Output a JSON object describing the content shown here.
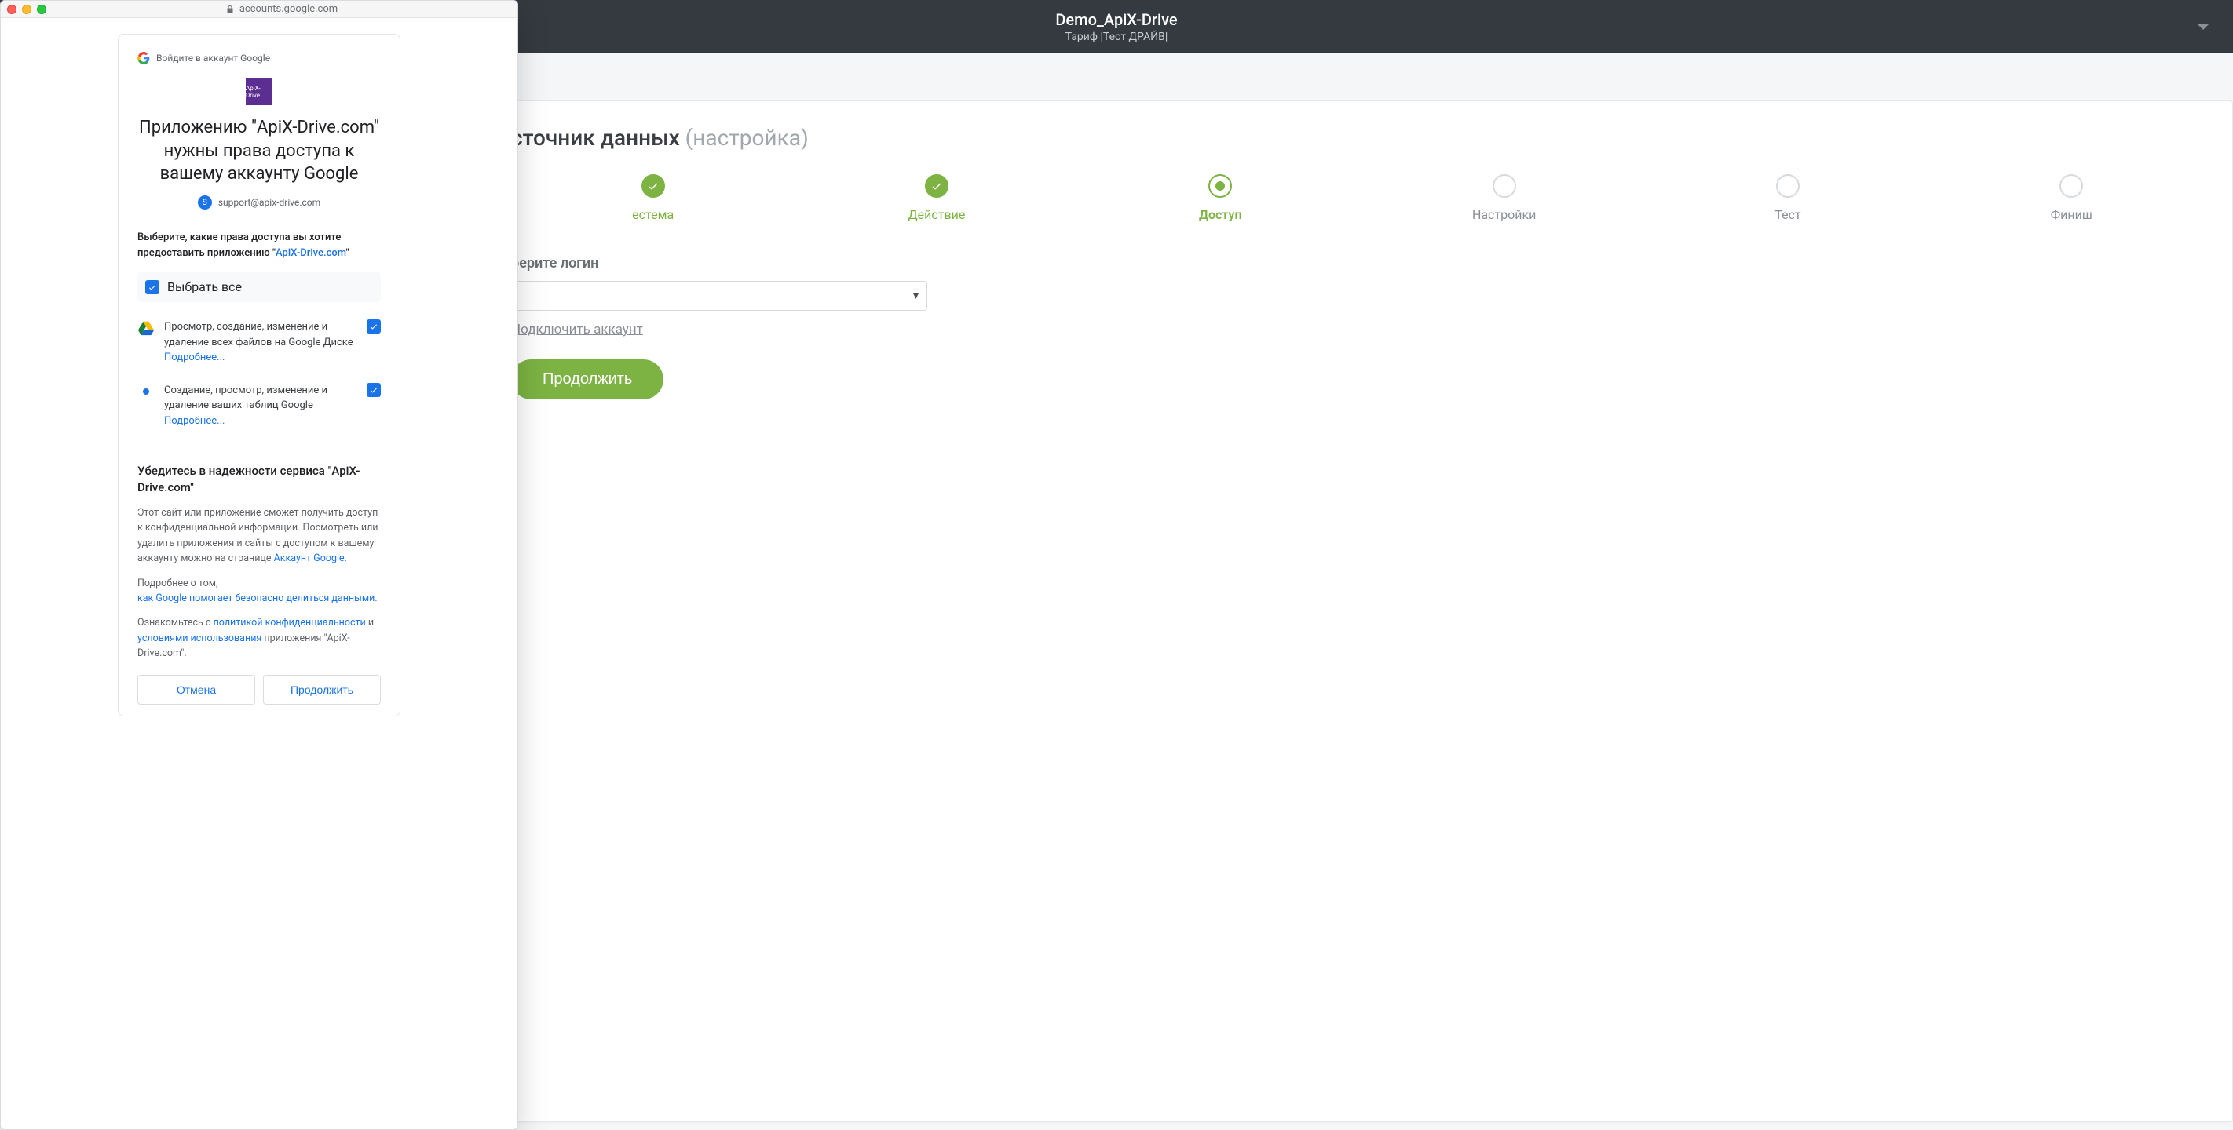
{
  "app": {
    "header": {
      "title": "Demo_ApiX-Drive",
      "subtitle": "Тариф |Тест ДРАЙВ|"
    },
    "panel": {
      "title_main": "сточник данных",
      "title_muted": "(настройка)",
      "steps": [
        {
          "label": "естема",
          "state": "done"
        },
        {
          "label": "Действие",
          "state": "done"
        },
        {
          "label": "Доступ",
          "state": "active"
        },
        {
          "label": "Настройки",
          "state": ""
        },
        {
          "label": "Тест",
          "state": ""
        },
        {
          "label": "Финиш",
          "state": ""
        }
      ],
      "field_label": "берите логин",
      "connect_link": "Подключить аккаунт",
      "continue": "Продолжить"
    }
  },
  "popup": {
    "url": "accounts.google.com",
    "brand_text": "Войдите в аккаунт Google",
    "app_icon_text": "ApiX-Drive",
    "heading": "Приложению \"ApiX-Drive.com\" нужны права доступа к вашему аккаунту Google",
    "account_chip_letter": "S",
    "account_email": "support@apix-drive.com",
    "select_title_1": "Выберите, какие права доступа вы хотите предоставить приложению \"",
    "select_title_app": "ApiX-Drive.com",
    "select_title_2": "\"",
    "select_all": "Выбрать все",
    "perms": [
      {
        "icon": "drive",
        "text": "Просмотр, создание, изменение и удаление всех файлов на Google Диске",
        "more": "Подробнее..."
      },
      {
        "icon": "sheets",
        "text": "Создание, просмотр, изменение и удаление ваших таблиц Google",
        "more": "Подробнее..."
      }
    ],
    "trust_head": "Убедитесь в надежности сервиса \"ApiX-Drive.com\"",
    "trust_para": "Этот сайт или приложение сможет получить доступ к конфиденциальной информации. Посмотреть или удалить приложения и сайты с доступом к вашему аккаунту можно на странице ",
    "trust_link": "Аккаунт Google",
    "safe_para1": "Подробнее о том,",
    "safe_link": "как Google помогает безопасно делиться данными",
    "tos_pre": "Ознакомьтесь с ",
    "tos_link1": "политикой конфиденциальности",
    "tos_mid": " и ",
    "tos_link2": "условиями использования",
    "tos_post": " приложения \"ApiX-Drive.com\".",
    "btn_cancel": "Отмена",
    "btn_continue": "Продолжить"
  }
}
